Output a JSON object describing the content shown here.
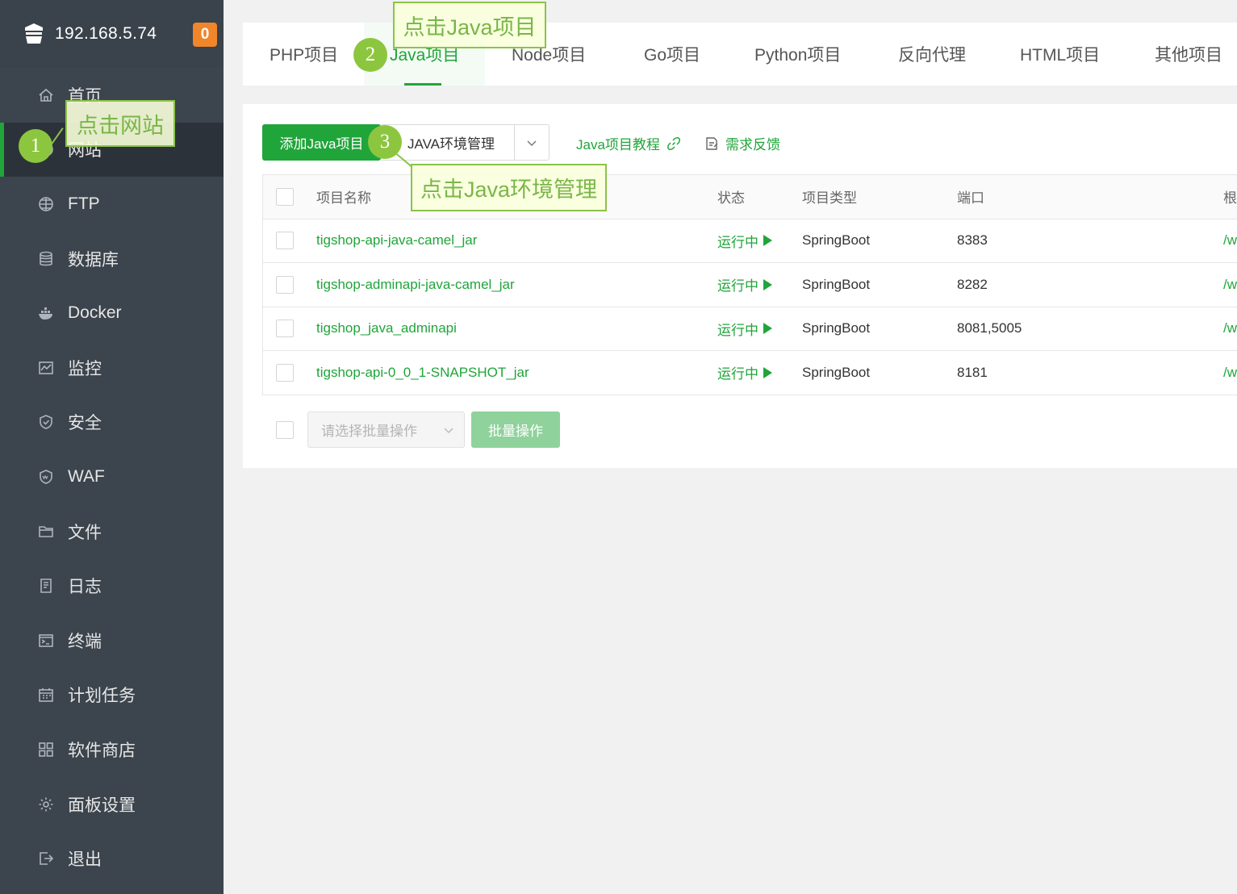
{
  "sidebar": {
    "server_ip": "192.168.5.74",
    "message_count": "0",
    "items": [
      {
        "label": "首页",
        "icon": "home-icon"
      },
      {
        "label": "网站",
        "icon": "globe-icon",
        "active": true
      },
      {
        "label": "FTP",
        "icon": "ftp-icon"
      },
      {
        "label": "数据库",
        "icon": "database-icon"
      },
      {
        "label": "Docker",
        "icon": "docker-icon"
      },
      {
        "label": "监控",
        "icon": "monitor-icon"
      },
      {
        "label": "安全",
        "icon": "shield-icon"
      },
      {
        "label": "WAF",
        "icon": "waf-icon"
      },
      {
        "label": "文件",
        "icon": "folder-icon"
      },
      {
        "label": "日志",
        "icon": "log-icon"
      },
      {
        "label": "终端",
        "icon": "terminal-icon"
      },
      {
        "label": "计划任务",
        "icon": "calendar-icon"
      },
      {
        "label": "软件商店",
        "icon": "apps-icon"
      },
      {
        "label": "面板设置",
        "icon": "settings-icon"
      },
      {
        "label": "退出",
        "icon": "logout-icon"
      }
    ]
  },
  "tabs": [
    {
      "label": "PHP项目"
    },
    {
      "label": "Java项目",
      "active": true
    },
    {
      "label": "Node项目"
    },
    {
      "label": "Go项目"
    },
    {
      "label": "Python项目"
    },
    {
      "label": "反向代理"
    },
    {
      "label": "HTML项目"
    },
    {
      "label": "其他项目"
    }
  ],
  "toolbar": {
    "add_label": "添加Java项目",
    "env_label": "JAVA环境管理",
    "tutorial_label": "Java项目教程",
    "feedback_label": "需求反馈"
  },
  "table": {
    "headers": {
      "name": "项目名称",
      "status": "状态",
      "type": "项目类型",
      "port": "端口",
      "path": "根"
    },
    "rows": [
      {
        "name": "tigshop-api-java-camel_jar",
        "status": "运行中",
        "type": "SpringBoot",
        "port": "8383",
        "path": "/w"
      },
      {
        "name": "tigshop-adminapi-java-camel_jar",
        "status": "运行中",
        "type": "SpringBoot",
        "port": "8282",
        "path": "/w"
      },
      {
        "name": "tigshop_java_adminapi",
        "status": "运行中",
        "type": "SpringBoot",
        "port": "8081,5005",
        "path": "/w"
      },
      {
        "name": "tigshop-api-0_0_1-SNAPSHOT_jar",
        "status": "运行中",
        "type": "SpringBoot",
        "port": "8181",
        "path": "/w"
      }
    ]
  },
  "batch": {
    "placeholder": "请选择批量操作",
    "button_label": "批量操作"
  },
  "annotations": {
    "step1": {
      "number": "1",
      "text": "点击网站"
    },
    "step2": {
      "number": "2",
      "text": "点击Java项目"
    },
    "step3": {
      "number": "3",
      "text": "点击Java环境管理"
    }
  },
  "colors": {
    "sidebar_bg": "#3c444d",
    "accent_green": "#20a53a",
    "badge_orange": "#f0852a",
    "annotation_green": "#8cc63f"
  }
}
